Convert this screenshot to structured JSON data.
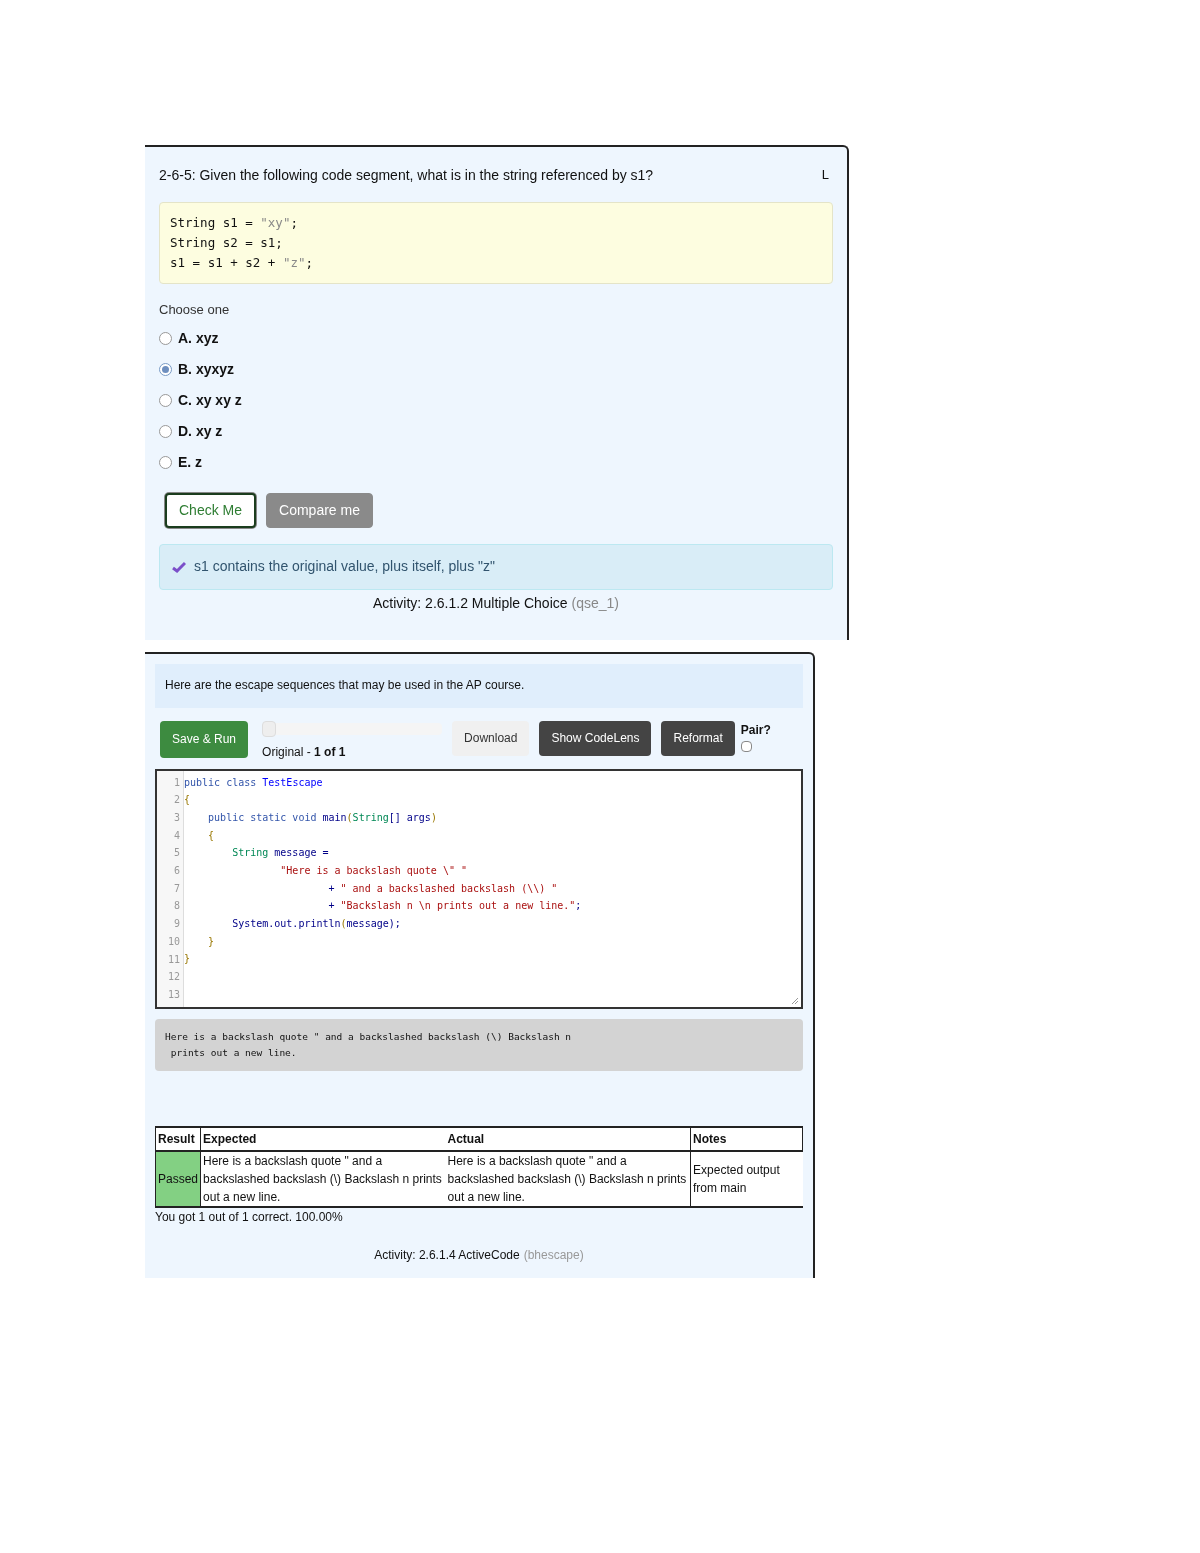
{
  "question": {
    "prompt": "2-6-5: Given the following code segment, what is in the string referenced by s1?",
    "corner_label": "L",
    "code": [
      [
        {
          "text": "String s1 = ",
          "kind": "plain"
        },
        {
          "text": "\"xy\"",
          "kind": "string"
        },
        {
          "text": ";",
          "kind": "plain"
        }
      ],
      [
        {
          "text": "String s2 = s1;",
          "kind": "plain"
        }
      ],
      [
        {
          "text": "s1 = s1 + s2 + ",
          "kind": "plain"
        },
        {
          "text": "\"z\"",
          "kind": "string"
        },
        {
          "text": ";",
          "kind": "plain"
        }
      ]
    ],
    "instruction": "Choose one",
    "options": [
      {
        "label": "A. xyz",
        "selected": false
      },
      {
        "label": "B. xyxyz",
        "selected": true
      },
      {
        "label": "C. xy xy z",
        "selected": false
      },
      {
        "label": "D. xy z",
        "selected": false
      },
      {
        "label": "E. z",
        "selected": false
      }
    ],
    "buttons": [
      {
        "label": "Check Me",
        "kind": "outline"
      },
      {
        "label": "Compare me",
        "kind": "grey"
      }
    ],
    "feedback": "s1 contains the original value, plus itself, plus \"z\"",
    "caption": "Activity: 2.6.1.2 Multiple Choice",
    "caption_id": "(qse_1)"
  },
  "activecode": {
    "intro": "Here are the escape sequences that may be used in the AP course.",
    "toolbar": [
      {
        "label": "Save & Run",
        "kind": "green"
      },
      {
        "label": "Download",
        "kind": "light"
      },
      {
        "label": "Show CodeLens",
        "kind": "dark"
      },
      {
        "label": "Reformat",
        "kind": "dark"
      }
    ],
    "history": {
      "level": 0,
      "label_plain": "Original - ",
      "label_bold": "1 of 1"
    },
    "pair": {
      "label": "Pair?",
      "checked": false
    },
    "lines": [
      {
        "num": "1",
        "tokens": [
          {
            "text": "public class ",
            "kind": "keyword"
          },
          {
            "text": "TestEscape",
            "kind": "def"
          }
        ]
      },
      {
        "num": "2",
        "tokens": [
          {
            "text": "{",
            "kind": "bracket"
          }
        ]
      },
      {
        "num": "3",
        "tokens": [
          {
            "text": "    public static void ",
            "kind": "keyword"
          },
          {
            "text": "main",
            "kind": "plain"
          },
          {
            "text": "(",
            "kind": "bracket"
          },
          {
            "text": "String",
            "kind": "type"
          },
          {
            "text": "[] args",
            "kind": "plain"
          },
          {
            "text": ")",
            "kind": "bracket"
          }
        ]
      },
      {
        "num": "4",
        "tokens": [
          {
            "text": "    {",
            "kind": "bracket"
          }
        ]
      },
      {
        "num": "5",
        "tokens": [
          {
            "text": "        String ",
            "kind": "type"
          },
          {
            "text": "message =",
            "kind": "plain"
          }
        ]
      },
      {
        "num": "6",
        "tokens": [
          {
            "text": "                \"Here is a backslash quote \\\" \"",
            "kind": "string"
          }
        ]
      },
      {
        "num": "7",
        "tokens": [
          {
            "text": "                        + ",
            "kind": "plain"
          },
          {
            "text": "\" and a backslashed backslash (\\\\) \"",
            "kind": "string"
          }
        ]
      },
      {
        "num": "8",
        "tokens": [
          {
            "text": "                        + ",
            "kind": "plain"
          },
          {
            "text": "\"Backslash n \\n prints out a new line.\"",
            "kind": "string"
          },
          {
            "text": ";",
            "kind": "plain"
          }
        ]
      },
      {
        "num": "9",
        "tokens": [
          {
            "text": "        System.out.println",
            "kind": "plain"
          },
          {
            "text": "(",
            "kind": "bracket"
          },
          {
            "text": "message",
            "kind": "plain"
          },
          {
            "text": ");",
            "kind": "plain"
          }
        ]
      },
      {
        "num": "10",
        "tokens": [
          {
            "text": "    }",
            "kind": "bracket"
          }
        ]
      },
      {
        "num": "11",
        "tokens": [
          {
            "text": "}",
            "kind": "bracket"
          }
        ]
      },
      {
        "num": "12"
      },
      {
        "num": "13"
      }
    ],
    "output": "Here is a backslash quote \" and a backslashed backslash (\\) Backslash n\n prints out a new line.",
    "results": {
      "columns": [
        "Result",
        "Expected",
        "Actual",
        "Notes"
      ],
      "rows": [
        {
          "passed": true,
          "result": "Passed",
          "expected": "Here is a backslash quote \" and a backslashed backslash (\\) Backslash n prints out a new line.",
          "actual": "Here is a backslash quote \" and a backslashed backslash (\\) Backslash n prints out a new line.",
          "notes": "Expected output from main"
        }
      ]
    },
    "summary": "You got 1 out of 1 correct. 100.00%",
    "caption": "Activity: 2.6.1.4 ActiveCode",
    "caption_id": "(bhescape)"
  }
}
